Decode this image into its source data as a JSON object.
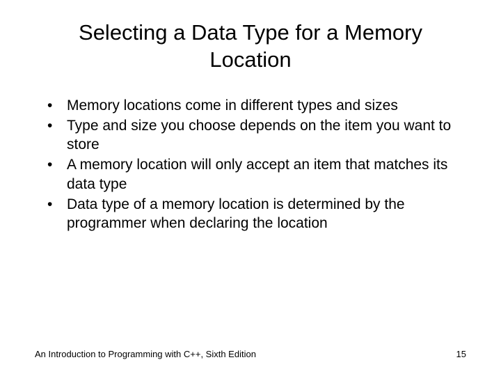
{
  "title": "Selecting a Data Type for a Memory Location",
  "bullets": [
    "Memory locations come in different types and sizes",
    "Type and size you choose depends on the item you want to store",
    "A memory location will only accept an item that matches its data type",
    "Data type of a memory location is determined by the programmer when declaring the location"
  ],
  "footer": {
    "left": "An Introduction to Programming with C++, Sixth Edition",
    "right": "15"
  }
}
